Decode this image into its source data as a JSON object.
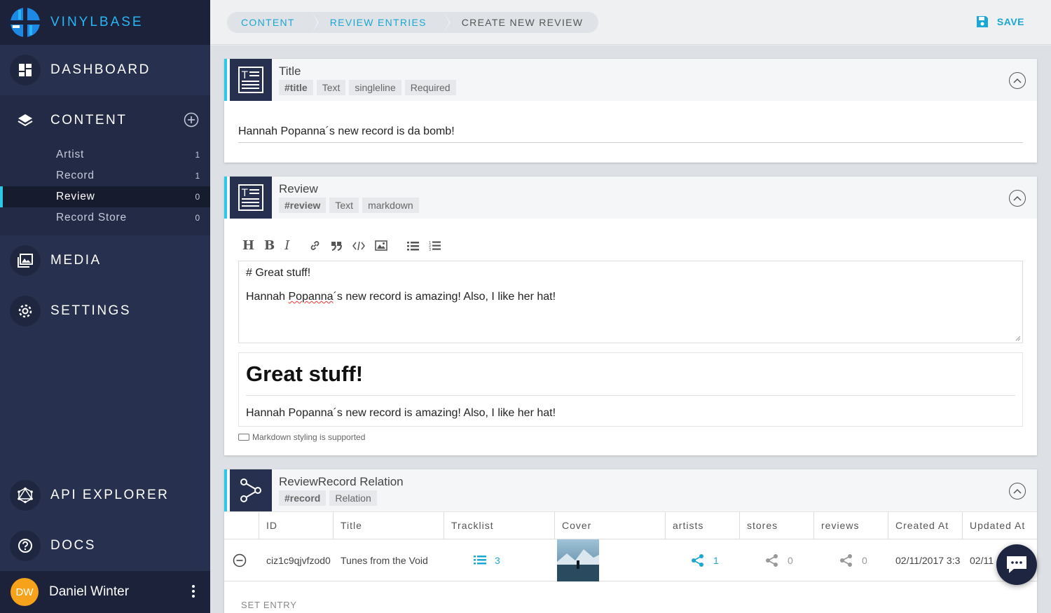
{
  "app": {
    "name": "VINYLBASE"
  },
  "sidebar": {
    "nav": {
      "dashboard": "DASHBOARD",
      "content": "CONTENT",
      "media": "MEDIA",
      "settings": "SETTINGS",
      "api_explorer": "API EXPLORER",
      "docs": "DOCS"
    },
    "content_items": [
      {
        "label": "Artist",
        "count": "1"
      },
      {
        "label": "Record",
        "count": "1"
      },
      {
        "label": "Review",
        "count": "0"
      },
      {
        "label": "Record Store",
        "count": "0"
      }
    ],
    "user": {
      "initials": "DW",
      "name": "Daniel Winter"
    }
  },
  "breadcrumb": [
    "CONTENT",
    "REVIEW ENTRIES",
    "CREATE NEW REVIEW"
  ],
  "toolbar": {
    "save_label": "SAVE"
  },
  "fields": {
    "title": {
      "name": "Title",
      "tags": [
        "#title",
        "Text",
        "singleline",
        "Required"
      ],
      "value": "Hannah Popanna´s new record is da bomb!"
    },
    "review": {
      "name": "Review",
      "tags": [
        "#review",
        "Text",
        "markdown"
      ],
      "editor_line1": "# Great stuff!",
      "editor_line2_a": "Hannah ",
      "editor_line2_b": "Popanna",
      "editor_line2_c": "´s new record is amazing! Also, I like her hat!",
      "preview_heading": "Great stuff!",
      "preview_body": "Hannah Popanna´s new record is amazing! Also, I like her hat!",
      "markdown_note": "Markdown styling is supported",
      "editor_buttons": [
        "H",
        "B",
        "I"
      ]
    },
    "relation": {
      "name": "ReviewRecord Relation",
      "tags": [
        "#record",
        "Relation"
      ],
      "columns": [
        "ID",
        "Title",
        "Tracklist",
        "Cover",
        "artists",
        "stores",
        "reviews",
        "Created At",
        "Updated At"
      ],
      "row": {
        "id": "ciz1c9qjvfzod0",
        "title": "Tunes from the Void",
        "tracklist": "3",
        "artists": "1",
        "stores": "0",
        "reviews": "0",
        "created_at": "02/11/2017 3:3",
        "updated_at": "02/11"
      },
      "set_entry": "SET ENTRY"
    }
  },
  "colors": {
    "accent": "#2ec7e6",
    "link": "#1ba7d3",
    "sidebar": "#28304f",
    "avatar": "#f7a21b"
  }
}
